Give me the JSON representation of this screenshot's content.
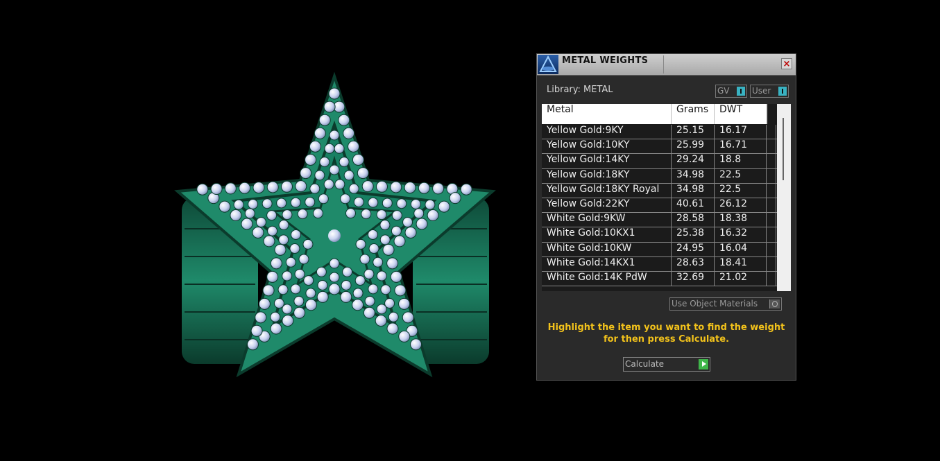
{
  "window": {
    "title": "METAL WEIGHTS",
    "close_glyph": "×",
    "library_label": "Library: METAL",
    "toggle_gv": "GV",
    "toggle_user": "User"
  },
  "table": {
    "headers": [
      "Metal",
      "Grams",
      "DWT"
    ],
    "rows": [
      {
        "metal": "Yellow Gold:9KY",
        "grams": "25.15",
        "dwt": "16.17"
      },
      {
        "metal": "Yellow Gold:10KY",
        "grams": "25.99",
        "dwt": "16.71"
      },
      {
        "metal": "Yellow Gold:14KY",
        "grams": "29.24",
        "dwt": "18.8"
      },
      {
        "metal": "Yellow Gold:18KY",
        "grams": "34.98",
        "dwt": "22.5"
      },
      {
        "metal": "Yellow Gold:18KY Royal",
        "grams": "34.98",
        "dwt": "22.5"
      },
      {
        "metal": "Yellow Gold:22KY",
        "grams": "40.61",
        "dwt": "26.12"
      },
      {
        "metal": "White Gold:9KW",
        "grams": "28.58",
        "dwt": "18.38"
      },
      {
        "metal": "White Gold:10KX1",
        "grams": "25.38",
        "dwt": "16.32"
      },
      {
        "metal": "White Gold:10KW",
        "grams": "24.95",
        "dwt": "16.04"
      },
      {
        "metal": "White Gold:14KX1",
        "grams": "28.63",
        "dwt": "18.41"
      },
      {
        "metal": "White Gold:14K PdW",
        "grams": "32.69",
        "dwt": "21.02"
      }
    ]
  },
  "options": {
    "use_object_materials": "Use Object Materials"
  },
  "hint_text": "Highlight the item you want to find the weight for then press Calculate.",
  "calculate_label": "Calculate",
  "colors": {
    "ring_metal": "#1f8a6a",
    "gem": "#c9d3f0",
    "hint": "#f2c21b",
    "accent": "#39b2c2",
    "go": "#3fb54a"
  }
}
